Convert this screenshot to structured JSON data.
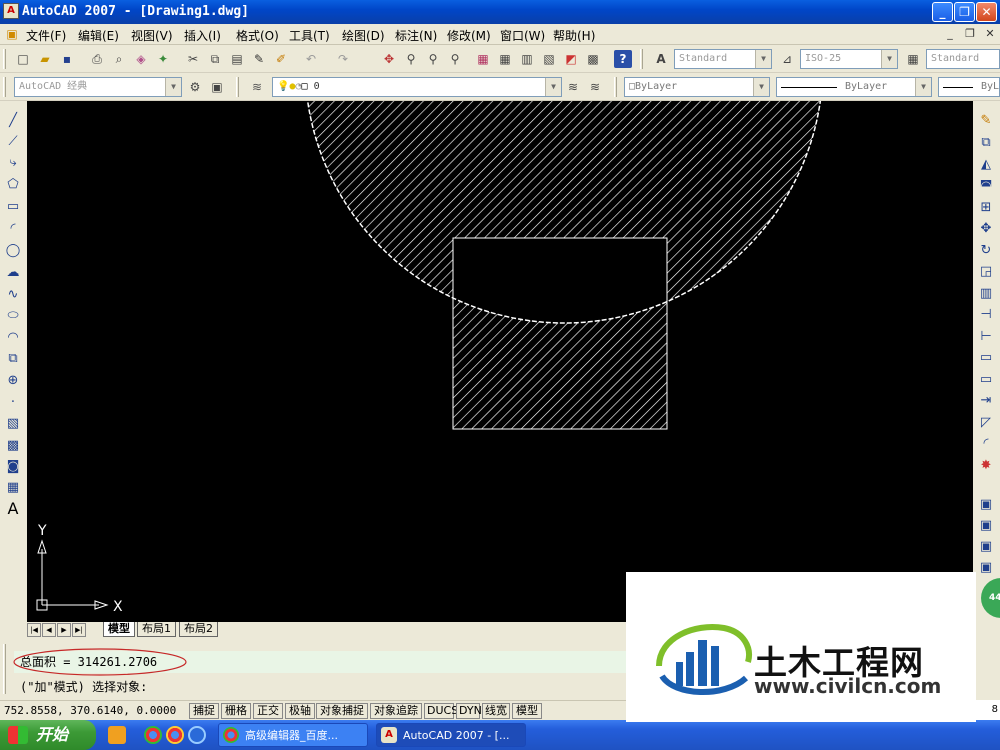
{
  "window": {
    "title": "AutoCAD 2007 - [Drawing1.dwg]",
    "min": "_",
    "max": "❐",
    "close": "✕",
    "mdi_min": "_",
    "mdi_restore": "❐",
    "mdi_close": "✕"
  },
  "menu": [
    "文件(F)",
    "编辑(E)",
    "视图(V)",
    "插入(I)",
    "格式(O)",
    "工具(T)",
    "绘图(D)",
    "标注(N)",
    "修改(M)",
    "窗口(W)",
    "帮助(H)"
  ],
  "toolbar": {
    "text_style": "Standard",
    "dim_style": "ISO-25",
    "table_style": "Standard",
    "workspace": "AutoCAD 经典",
    "layer": "0",
    "color": "ByLayer",
    "linetype": "ByLayer",
    "lineweight": "ByLay"
  },
  "drawing": {
    "ucs_x": "X",
    "ucs_y": "Y"
  },
  "tabs": [
    "模型",
    "布局1",
    "布局2"
  ],
  "command": {
    "line1": "总面积 = 314261.2706",
    "line2": "(\"加\"模式) 选择对象:"
  },
  "status": {
    "coords": "752.8558,  370.6140, 0.0000",
    "buttons": [
      "捕捉",
      "栅格",
      "正交",
      "极轴",
      "对象捕捉",
      "对象追踪",
      "DUCS",
      "DYN",
      "线宽",
      "模型"
    ]
  },
  "taskbar": {
    "start": "开始",
    "tasks": [
      "高级编辑器_百度...",
      "AutoCAD 2007 - [..."
    ],
    "tray_digit": "8"
  },
  "watermark": {
    "title": "土木工程网",
    "url": "www.civilcn.com",
    "badge": "44"
  },
  "colors": {
    "drawing_bg": "#000000",
    "hatch": "#ffffff",
    "titlebar": "#0a5fe0",
    "command_bg": "#e9f5e6",
    "taskbar": "#245edb",
    "start": "#3c9a36"
  }
}
